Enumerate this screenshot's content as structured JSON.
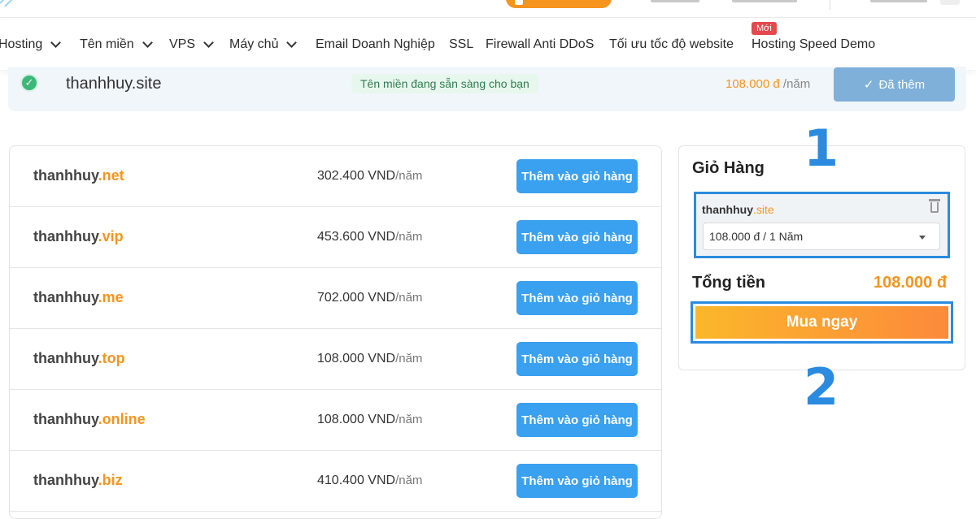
{
  "nav": {
    "items": [
      {
        "label": "Hosting",
        "dropdown": true
      },
      {
        "label": "Tên miền",
        "dropdown": true
      },
      {
        "label": "VPS",
        "dropdown": true
      },
      {
        "label": "Máy chủ",
        "dropdown": true
      },
      {
        "label": "Email Doanh Nghiệp",
        "dropdown": false
      },
      {
        "label": "SSL",
        "dropdown": false
      },
      {
        "label": "Firewall Anti DDoS",
        "dropdown": false
      },
      {
        "label": "Tối ưu tốc độ website",
        "dropdown": false
      },
      {
        "label": "Hosting Speed Demo",
        "dropdown": false
      }
    ],
    "new_badge": "Mới"
  },
  "selected": {
    "domain": "thanhhuy.site",
    "status": "Tên miền đang sẵn sàng cho bạn",
    "price": "108.000 đ",
    "period": "/năm",
    "added_label": "Đã thêm",
    "check_icon": "check-icon"
  },
  "domains": [
    {
      "name": "thanhhuy",
      "tld": ".net",
      "price": "302.400 VND",
      "unit": "/năm",
      "button": "Thêm vào giỏ hàng"
    },
    {
      "name": "thanhhuy",
      "tld": ".vip",
      "price": "453.600 VND",
      "unit": "/năm",
      "button": "Thêm vào giỏ hàng"
    },
    {
      "name": "thanhhuy",
      "tld": ".me",
      "price": "702.000 VND",
      "unit": "/năm",
      "button": "Thêm vào giỏ hàng"
    },
    {
      "name": "thanhhuy",
      "tld": ".top",
      "price": "108.000 VND",
      "unit": "/năm",
      "button": "Thêm vào giỏ hàng"
    },
    {
      "name": "thanhhuy",
      "tld": ".online",
      "price": "108.000 VND",
      "unit": "/năm",
      "button": "Thêm vào giỏ hàng"
    },
    {
      "name": "thanhhuy",
      "tld": ".biz",
      "price": "410.400 VND",
      "unit": "/năm",
      "button": "Thêm vào giỏ hàng"
    }
  ],
  "cart": {
    "title": "Giỏ Hàng",
    "item_name": "thanhhuy",
    "item_tld": ".site",
    "option": "108.000 đ / 1 Năm",
    "total_label": "Tổng tiền",
    "total": "108.000 đ",
    "buy_label": "Mua ngay"
  },
  "annotations": {
    "step1": "1",
    "step2": "2"
  },
  "colors": {
    "accent": "#f7941d",
    "primary": "#3aa0f0",
    "annotation": "#2a8be0",
    "success": "#3cb878"
  }
}
